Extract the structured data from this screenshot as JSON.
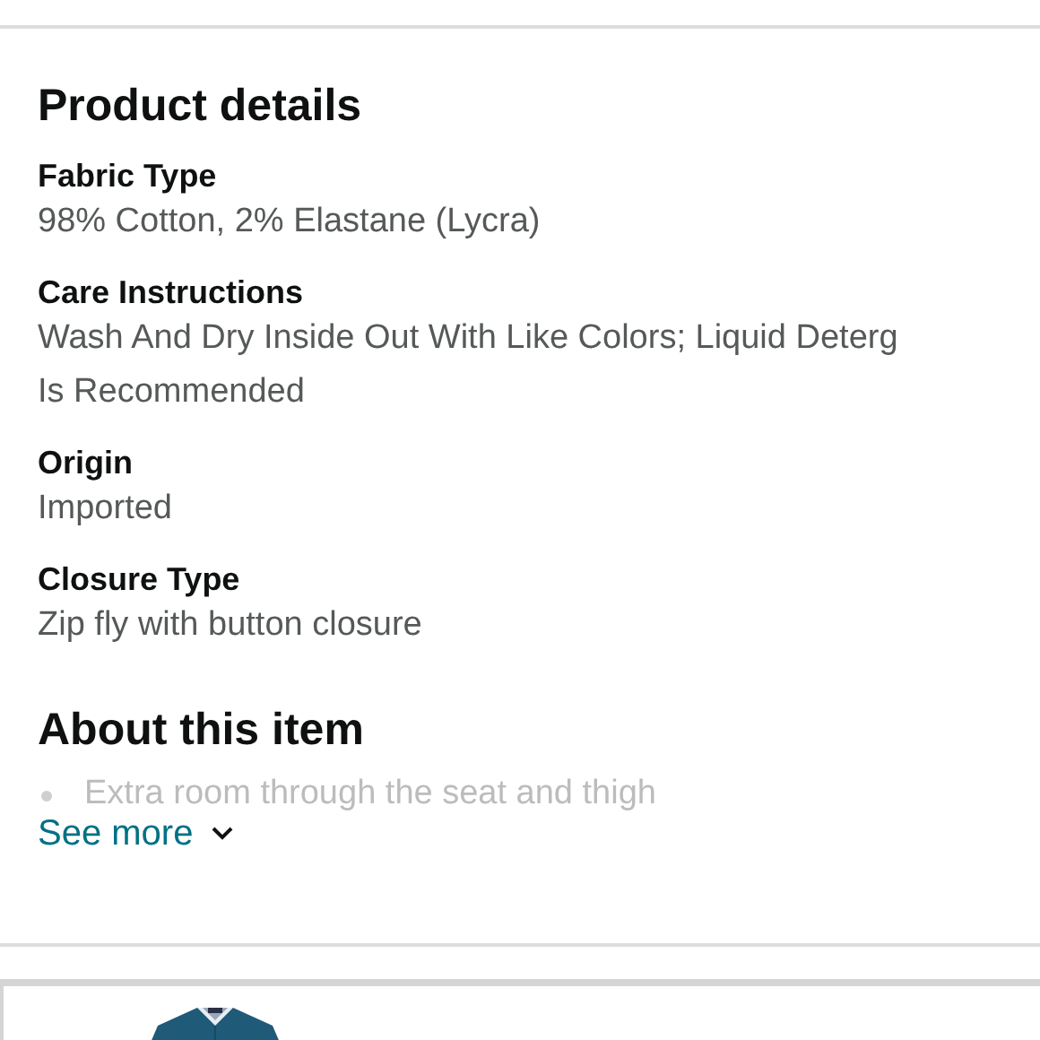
{
  "product_details": {
    "title": "Product details",
    "attributes": [
      {
        "label": "Fabric Type",
        "value_lines": [
          "98% Cotton, 2% Elastane (Lycra)"
        ]
      },
      {
        "label": "Care Instructions",
        "value_lines": [
          "Wash And Dry Inside Out With Like Colors; Liquid Deterg",
          "Is Recommended"
        ]
      },
      {
        "label": "Origin",
        "value_lines": [
          "Imported"
        ]
      },
      {
        "label": "Closure Type",
        "value_lines": [
          "Zip fly with button closure"
        ]
      }
    ]
  },
  "about": {
    "title": "About this item",
    "bullets": [
      "Extra room through the seat and thigh"
    ],
    "see_more": {
      "label": "See more",
      "expanded": false
    }
  }
}
